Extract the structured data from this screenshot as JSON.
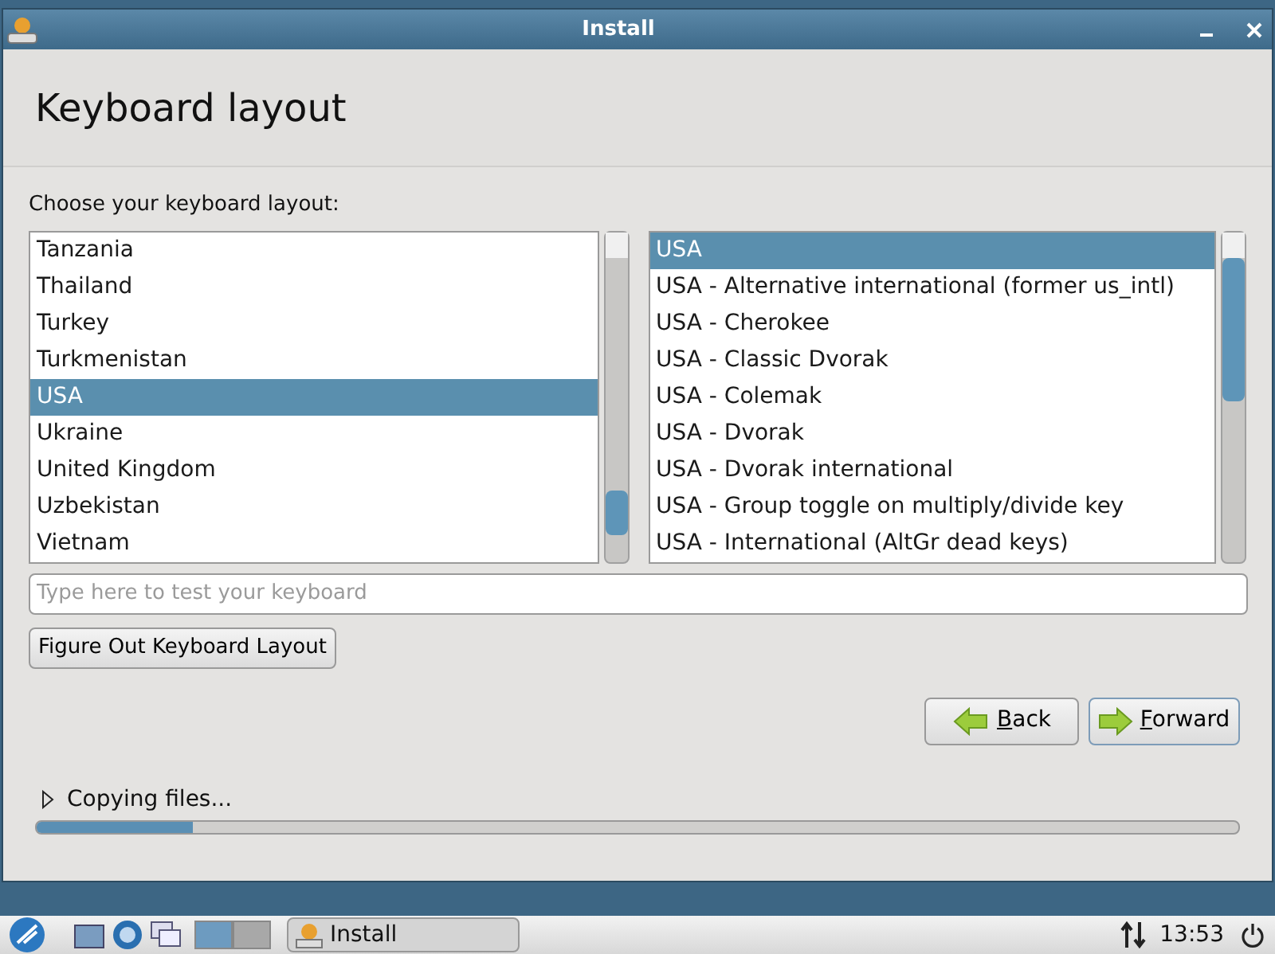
{
  "window": {
    "title": "Install"
  },
  "heading": "Keyboard layout",
  "prompt": "Choose your keyboard layout:",
  "countries": [
    {
      "label": "Tanzania",
      "selected": false
    },
    {
      "label": "Thailand",
      "selected": false
    },
    {
      "label": "Turkey",
      "selected": false
    },
    {
      "label": "Turkmenistan",
      "selected": false
    },
    {
      "label": "USA",
      "selected": true
    },
    {
      "label": "Ukraine",
      "selected": false
    },
    {
      "label": "United Kingdom",
      "selected": false
    },
    {
      "label": "Uzbekistan",
      "selected": false
    },
    {
      "label": "Vietnam",
      "selected": false
    }
  ],
  "variants": [
    {
      "label": "USA",
      "selected": true
    },
    {
      "label": "USA - Alternative international (former us_intl)",
      "selected": false
    },
    {
      "label": "USA - Cherokee",
      "selected": false
    },
    {
      "label": "USA - Classic Dvorak",
      "selected": false
    },
    {
      "label": "USA - Colemak",
      "selected": false
    },
    {
      "label": "USA - Dvorak",
      "selected": false
    },
    {
      "label": "USA - Dvorak international",
      "selected": false
    },
    {
      "label": "USA - Group toggle on multiply/divide key",
      "selected": false
    },
    {
      "label": "USA - International (AltGr dead keys)",
      "selected": false
    }
  ],
  "test_field": {
    "placeholder": "Type here to test your keyboard"
  },
  "figure_out_button": "Figure Out Keyboard Layout",
  "back_button": "Back",
  "forward_button": "Forward",
  "progress": {
    "label": "Copying files...",
    "level": 0.13
  },
  "taskbar": {
    "workspaces": [
      {
        "selected": true
      },
      {
        "selected": false
      }
    ],
    "task": "Install",
    "clock": "13:53"
  }
}
